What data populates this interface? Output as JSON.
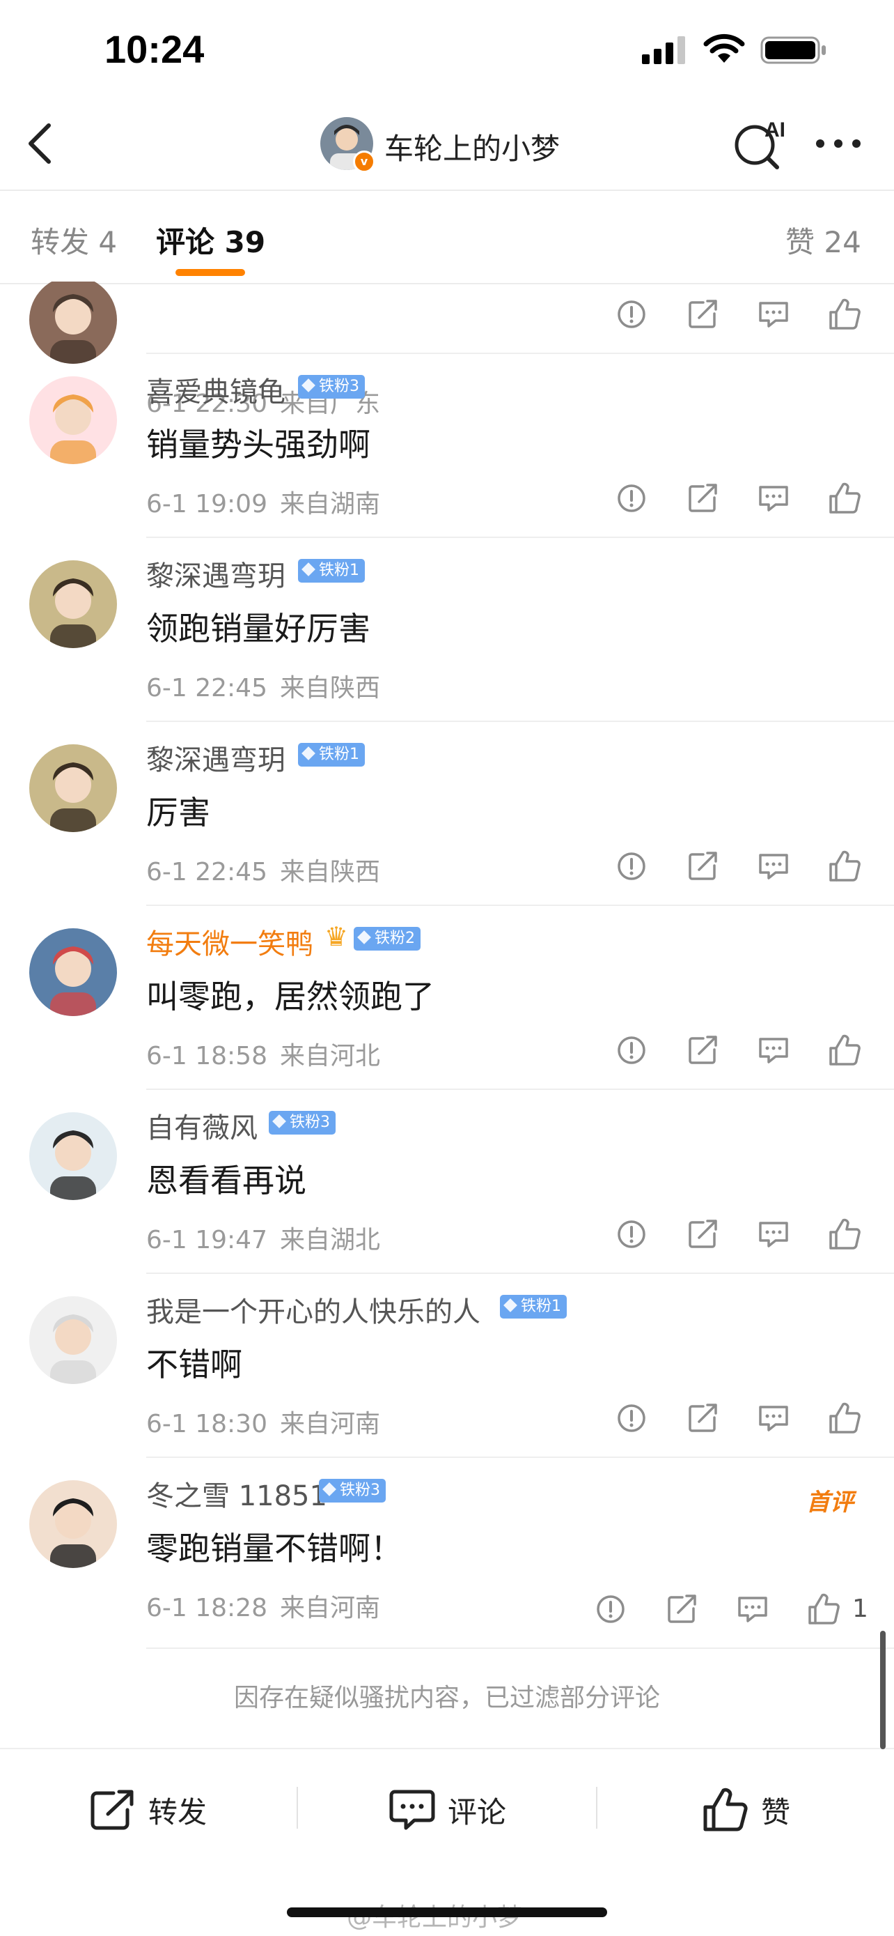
{
  "status_bar": {
    "time": "10:24"
  },
  "nav": {
    "author_name": "车轮上的小梦",
    "ai_label": "AI"
  },
  "tabs": [
    {
      "label": "转发 4"
    },
    {
      "label": "评论 39"
    },
    {
      "label": "赞 24"
    }
  ],
  "comments": [
    {
      "name": "",
      "fan_badge": "",
      "text": "",
      "time": "6-1 22:30",
      "location": "来自广东",
      "actions": true
    },
    {
      "name": "喜爱典镜龟",
      "fan_badge": "铁粉3",
      "text": "销量势头强劲啊",
      "time": "6-1 19:09",
      "location": "来自湖南",
      "actions": true
    },
    {
      "name": "黎深遇弯玥",
      "fan_badge": "铁粉1",
      "text": "领跑销量好厉害",
      "time": "6-1 22:45",
      "location": "来自陕西",
      "actions": false
    },
    {
      "name": "黎深遇弯玥",
      "fan_badge": "铁粉1",
      "text": "厉害",
      "time": "6-1 22:45",
      "location": "来自陕西",
      "actions": true
    },
    {
      "name": "每天微一笑鸭",
      "fan_badge": "铁粉2",
      "text": "叫零跑，居然领跑了",
      "time": "6-1 18:58",
      "location": "来自河北",
      "actions": true,
      "vip": true
    },
    {
      "name": "自有薇风",
      "fan_badge": "铁粉3",
      "text": "恩看看再说",
      "time": "6-1 19:47",
      "location": "来自湖北",
      "actions": true
    },
    {
      "name": "我是一个开心的人快乐的人",
      "fan_badge": "铁粉1",
      "text": "不错啊",
      "time": "6-1 18:30",
      "location": "来自河南",
      "actions": true
    },
    {
      "name": "冬之雪 11851",
      "fan_badge": "铁粉3",
      "text": "零跑销量不错啊！",
      "time": "6-1 18:28",
      "location": "来自河南",
      "actions": true,
      "like_count": "1",
      "first_badge": "首评"
    }
  ],
  "filter_notice": "因存在疑似骚扰内容，已过滤部分评论",
  "bottom_bar": {
    "repost": "转发",
    "comment": "评论",
    "like": "赞"
  },
  "watermark": "@车轮上的小梦",
  "colors": {
    "accent": "#ff8200",
    "vip_name": "#f27d10",
    "fan_badge": "#6aa6f1"
  }
}
